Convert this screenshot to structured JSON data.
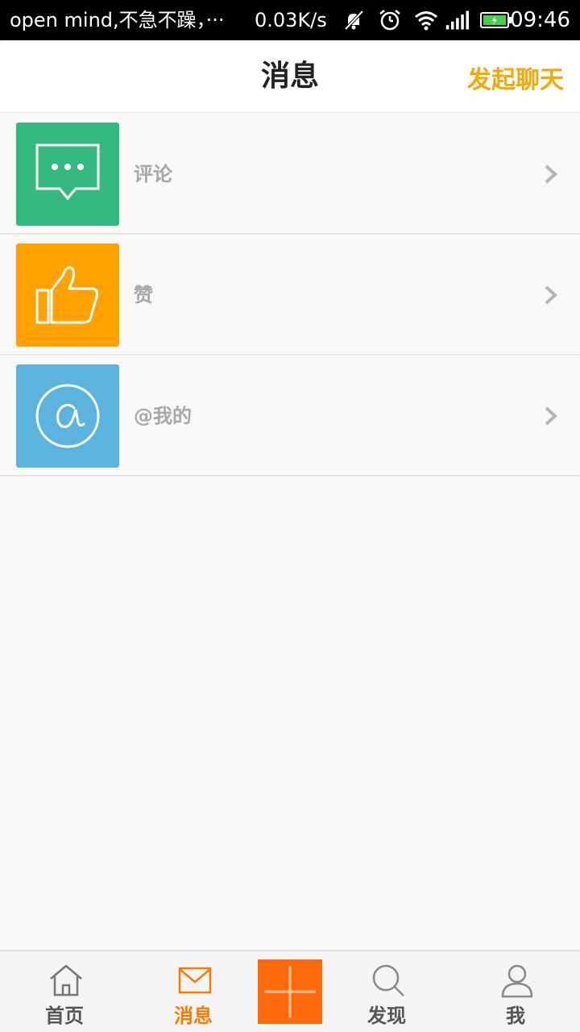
{
  "status_bar": {
    "notification_text": "open mind,不急不躁，···",
    "network_speed": "0.03K/s",
    "time": "09:46",
    "icons": [
      "mute-icon",
      "alarm-icon",
      "wifi-icon",
      "signal-icon",
      "battery-icon"
    ]
  },
  "header": {
    "title": "消息",
    "action_label": "发起聊天"
  },
  "list": {
    "items": [
      {
        "label": "评论",
        "icon": "comment-icon",
        "color": "#34b882"
      },
      {
        "label": "赞",
        "icon": "thumbs-up-icon",
        "color": "#ffa200"
      },
      {
        "label": "@我的",
        "icon": "at-icon",
        "color": "#5bb4de"
      }
    ]
  },
  "bottom_nav": {
    "items": [
      {
        "label": "首页",
        "icon": "home-icon"
      },
      {
        "label": "消息",
        "icon": "mail-icon",
        "active": true
      },
      {
        "label": "",
        "icon": "plus-icon"
      },
      {
        "label": "发现",
        "icon": "search-icon"
      },
      {
        "label": "我",
        "icon": "person-icon"
      }
    ]
  },
  "colors": {
    "accent": "#f5a80a",
    "active_tab": "#f57c00",
    "plus_button": "#ff6a0a"
  }
}
